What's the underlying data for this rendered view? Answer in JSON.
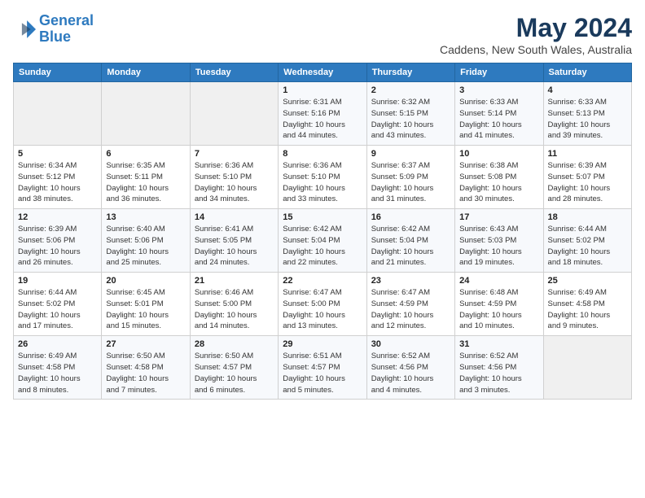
{
  "logo": {
    "line1": "General",
    "line2": "Blue"
  },
  "title": "May 2024",
  "subtitle": "Caddens, New South Wales, Australia",
  "days_of_week": [
    "Sunday",
    "Monday",
    "Tuesday",
    "Wednesday",
    "Thursday",
    "Friday",
    "Saturday"
  ],
  "weeks": [
    [
      {
        "day": "",
        "info": ""
      },
      {
        "day": "",
        "info": ""
      },
      {
        "day": "",
        "info": ""
      },
      {
        "day": "1",
        "info": "Sunrise: 6:31 AM\nSunset: 5:16 PM\nDaylight: 10 hours\nand 44 minutes."
      },
      {
        "day": "2",
        "info": "Sunrise: 6:32 AM\nSunset: 5:15 PM\nDaylight: 10 hours\nand 43 minutes."
      },
      {
        "day": "3",
        "info": "Sunrise: 6:33 AM\nSunset: 5:14 PM\nDaylight: 10 hours\nand 41 minutes."
      },
      {
        "day": "4",
        "info": "Sunrise: 6:33 AM\nSunset: 5:13 PM\nDaylight: 10 hours\nand 39 minutes."
      }
    ],
    [
      {
        "day": "5",
        "info": "Sunrise: 6:34 AM\nSunset: 5:12 PM\nDaylight: 10 hours\nand 38 minutes."
      },
      {
        "day": "6",
        "info": "Sunrise: 6:35 AM\nSunset: 5:11 PM\nDaylight: 10 hours\nand 36 minutes."
      },
      {
        "day": "7",
        "info": "Sunrise: 6:36 AM\nSunset: 5:10 PM\nDaylight: 10 hours\nand 34 minutes."
      },
      {
        "day": "8",
        "info": "Sunrise: 6:36 AM\nSunset: 5:10 PM\nDaylight: 10 hours\nand 33 minutes."
      },
      {
        "day": "9",
        "info": "Sunrise: 6:37 AM\nSunset: 5:09 PM\nDaylight: 10 hours\nand 31 minutes."
      },
      {
        "day": "10",
        "info": "Sunrise: 6:38 AM\nSunset: 5:08 PM\nDaylight: 10 hours\nand 30 minutes."
      },
      {
        "day": "11",
        "info": "Sunrise: 6:39 AM\nSunset: 5:07 PM\nDaylight: 10 hours\nand 28 minutes."
      }
    ],
    [
      {
        "day": "12",
        "info": "Sunrise: 6:39 AM\nSunset: 5:06 PM\nDaylight: 10 hours\nand 26 minutes."
      },
      {
        "day": "13",
        "info": "Sunrise: 6:40 AM\nSunset: 5:06 PM\nDaylight: 10 hours\nand 25 minutes."
      },
      {
        "day": "14",
        "info": "Sunrise: 6:41 AM\nSunset: 5:05 PM\nDaylight: 10 hours\nand 24 minutes."
      },
      {
        "day": "15",
        "info": "Sunrise: 6:42 AM\nSunset: 5:04 PM\nDaylight: 10 hours\nand 22 minutes."
      },
      {
        "day": "16",
        "info": "Sunrise: 6:42 AM\nSunset: 5:04 PM\nDaylight: 10 hours\nand 21 minutes."
      },
      {
        "day": "17",
        "info": "Sunrise: 6:43 AM\nSunset: 5:03 PM\nDaylight: 10 hours\nand 19 minutes."
      },
      {
        "day": "18",
        "info": "Sunrise: 6:44 AM\nSunset: 5:02 PM\nDaylight: 10 hours\nand 18 minutes."
      }
    ],
    [
      {
        "day": "19",
        "info": "Sunrise: 6:44 AM\nSunset: 5:02 PM\nDaylight: 10 hours\nand 17 minutes."
      },
      {
        "day": "20",
        "info": "Sunrise: 6:45 AM\nSunset: 5:01 PM\nDaylight: 10 hours\nand 15 minutes."
      },
      {
        "day": "21",
        "info": "Sunrise: 6:46 AM\nSunset: 5:00 PM\nDaylight: 10 hours\nand 14 minutes."
      },
      {
        "day": "22",
        "info": "Sunrise: 6:47 AM\nSunset: 5:00 PM\nDaylight: 10 hours\nand 13 minutes."
      },
      {
        "day": "23",
        "info": "Sunrise: 6:47 AM\nSunset: 4:59 PM\nDaylight: 10 hours\nand 12 minutes."
      },
      {
        "day": "24",
        "info": "Sunrise: 6:48 AM\nSunset: 4:59 PM\nDaylight: 10 hours\nand 10 minutes."
      },
      {
        "day": "25",
        "info": "Sunrise: 6:49 AM\nSunset: 4:58 PM\nDaylight: 10 hours\nand 9 minutes."
      }
    ],
    [
      {
        "day": "26",
        "info": "Sunrise: 6:49 AM\nSunset: 4:58 PM\nDaylight: 10 hours\nand 8 minutes."
      },
      {
        "day": "27",
        "info": "Sunrise: 6:50 AM\nSunset: 4:58 PM\nDaylight: 10 hours\nand 7 minutes."
      },
      {
        "day": "28",
        "info": "Sunrise: 6:50 AM\nSunset: 4:57 PM\nDaylight: 10 hours\nand 6 minutes."
      },
      {
        "day": "29",
        "info": "Sunrise: 6:51 AM\nSunset: 4:57 PM\nDaylight: 10 hours\nand 5 minutes."
      },
      {
        "day": "30",
        "info": "Sunrise: 6:52 AM\nSunset: 4:56 PM\nDaylight: 10 hours\nand 4 minutes."
      },
      {
        "day": "31",
        "info": "Sunrise: 6:52 AM\nSunset: 4:56 PM\nDaylight: 10 hours\nand 3 minutes."
      },
      {
        "day": "",
        "info": ""
      }
    ]
  ]
}
